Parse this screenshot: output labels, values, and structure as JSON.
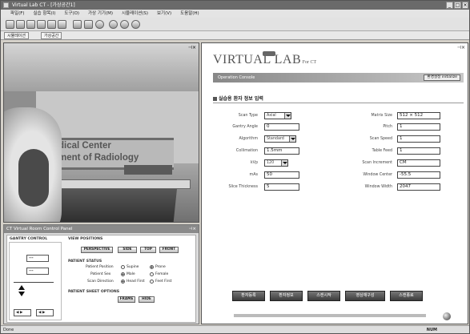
{
  "window": {
    "title": "Virtual Lab CT - [가상공간1]"
  },
  "menu": [
    "파일(F)",
    "실습 항목(I)",
    "도구(O)",
    "가상 기기(M)",
    "시뮬레이션(S)",
    "보기(V)",
    "도움말(H)"
  ],
  "doc_tabs": [
    "시뮬레이션",
    "가상공간"
  ],
  "scene": {
    "sign_line1": "dical Center",
    "sign_line2": "ment of Radiology"
  },
  "control_panel": {
    "title": "CT Virtual Room Control Panel",
    "gantry_section": "GANTRY CONTROL",
    "view_section": "VIEW POSITIONS",
    "view_buttons": [
      "PERSPECTIVE",
      "SIDE",
      "TOP",
      "FRONT"
    ],
    "patient_section": "PATIENT STATUS",
    "patient_position_label": "Patient Position",
    "patient_position_options": [
      "Supine",
      "Prone"
    ],
    "patient_sex_label": "Patient Sex",
    "patient_sex_options": [
      "Male",
      "Female"
    ],
    "scan_direction_label": "Scan Direction",
    "scan_direction_options": [
      "Head First",
      "Feet First"
    ],
    "patient_sheet_section": "PATIENT SHEET OPTIONS",
    "sheet_buttons": [
      "FRAME",
      "HIDE"
    ],
    "gantry_combo_1": "---",
    "gantry_combo_2": "---"
  },
  "form": {
    "brand_big": "VIRTUAL LAB",
    "brand_for": "For CT",
    "banner_text": "Operation Console",
    "banner_button": "환경설정 initialize",
    "title": "실습용 환자 정보 입력",
    "left_fields": [
      {
        "label": "Scan Type",
        "value": "Axial",
        "type": "combo"
      },
      {
        "label": "Gantry Angle",
        "value": "0",
        "type": "input"
      },
      {
        "label": "Algorithm",
        "value": "Standard",
        "type": "combo"
      },
      {
        "label": "Collimation",
        "value": "1.5mm",
        "type": "input"
      },
      {
        "label": "kVp",
        "value": "120",
        "type": "combo"
      },
      {
        "label": "mAs",
        "value": "50",
        "type": "input"
      },
      {
        "label": "Slice Thickness",
        "value": "5",
        "type": "input"
      }
    ],
    "right_fields": [
      {
        "label": "Matrix Size",
        "value": "512 × 512"
      },
      {
        "label": "Pitch",
        "value": "1"
      },
      {
        "label": "Scan Speed",
        "value": "1"
      },
      {
        "label": "Table Feed",
        "value": "1"
      },
      {
        "label": "Scan Increment",
        "value": "CM"
      },
      {
        "label": "Window Center",
        "value": "-55.5"
      },
      {
        "label": "Window Width",
        "value": "2047"
      }
    ],
    "action_buttons": [
      "환자등록",
      "환자정보",
      "스캔시작",
      "영상재구성",
      "스캔종료"
    ]
  },
  "status": {
    "left": "Done",
    "right": "NUM"
  }
}
